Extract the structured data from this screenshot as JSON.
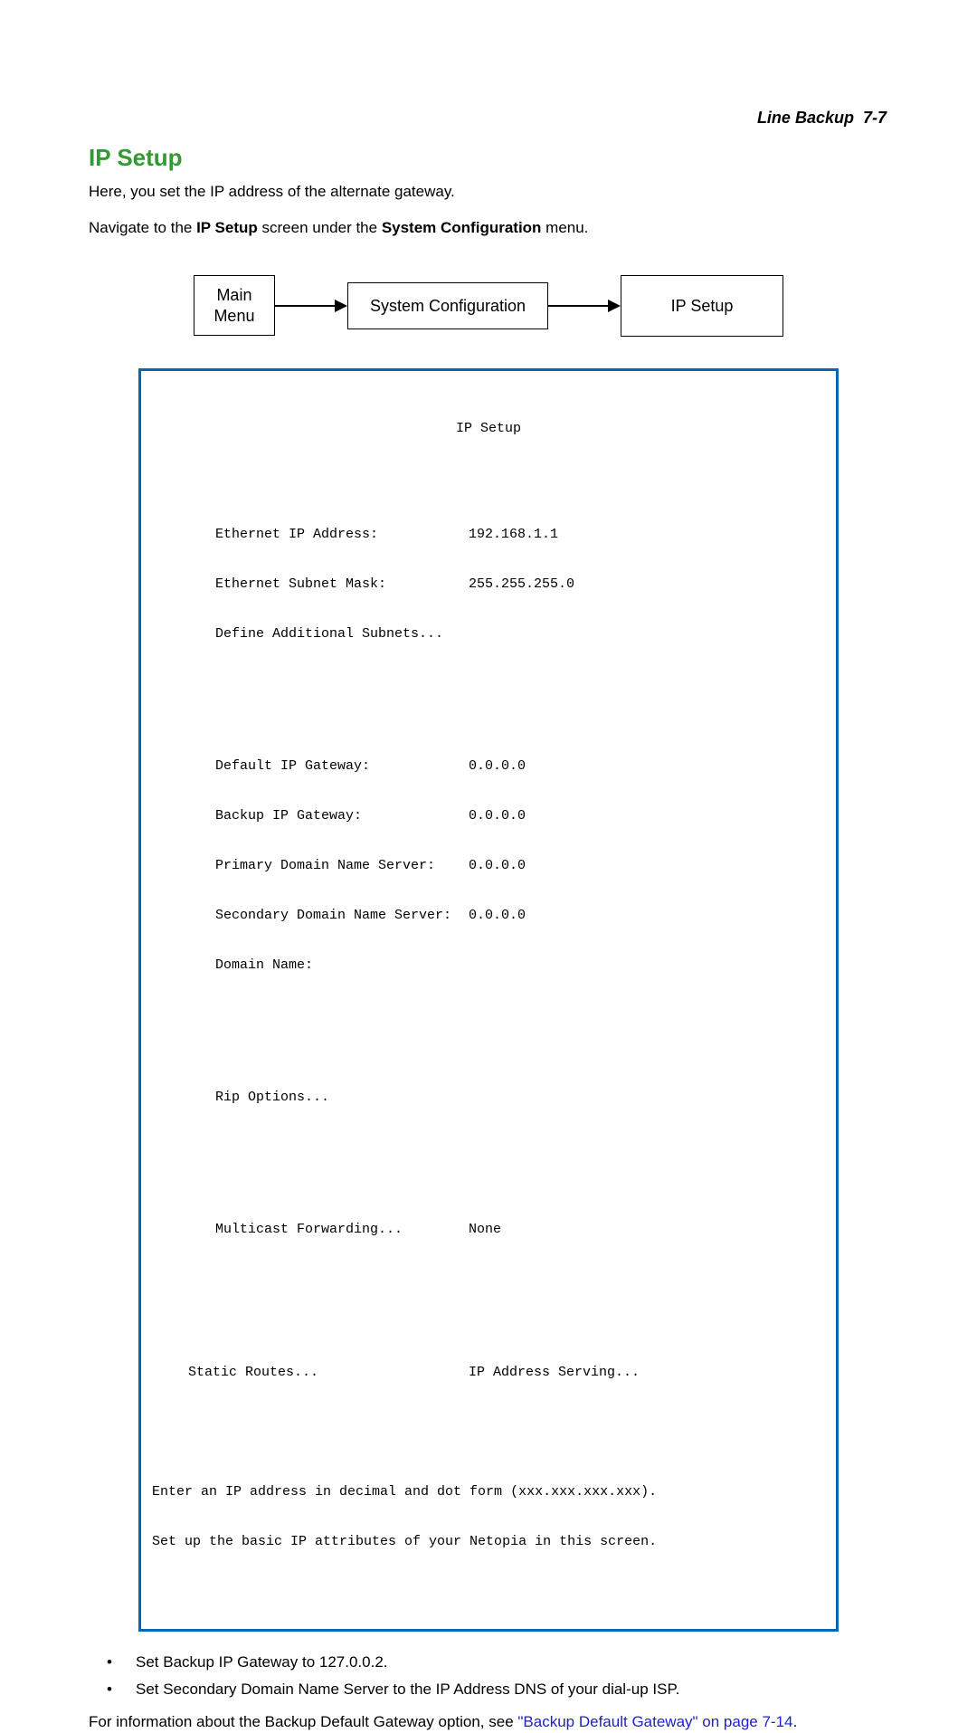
{
  "header": {
    "section": "Line Backup",
    "page": "7-7"
  },
  "heading": "IP Setup",
  "intro": "Here, you set the IP address of the alternate gateway.",
  "nav_text": {
    "pre": "Navigate to the ",
    "bold1": "IP Setup",
    "mid": " screen under the ",
    "bold2": "System Configuration",
    "post": " menu."
  },
  "diagram": {
    "box1_l1": "Main",
    "box1_l2": "Menu",
    "box2": "System Configuration",
    "box3": "IP Setup"
  },
  "terminal": {
    "title": "IP Setup",
    "rows1": [
      {
        "label": "Ethernet IP Address:",
        "value": "192.168.1.1"
      },
      {
        "label": "Ethernet Subnet Mask:",
        "value": "255.255.255.0"
      },
      {
        "label": "Define Additional Subnets...",
        "value": ""
      }
    ],
    "rows2": [
      {
        "label": "Default IP Gateway:",
        "value": "0.0.0.0"
      },
      {
        "label": "Backup IP Gateway:",
        "value": "0.0.0.0"
      },
      {
        "label": "Primary Domain Name Server:",
        "value": "0.0.0.0"
      },
      {
        "label": "Secondary Domain Name Server:",
        "value": "0.0.0.0"
      },
      {
        "label": "Domain Name:",
        "value": ""
      }
    ],
    "rows3": [
      {
        "label": "Rip Options...",
        "value": ""
      }
    ],
    "rows4": [
      {
        "label": "Multicast Forwarding...",
        "value": "None"
      }
    ],
    "bottom_left": "Static Routes...",
    "bottom_right": "IP Address Serving...",
    "footer1": "Enter an IP address in decimal and dot form (xxx.xxx.xxx.xxx).",
    "footer2": "Set up the basic IP attributes of your Netopia in this screen."
  },
  "bullets": [
    {
      "pre": "Set ",
      "bold": "Backup IP Gateway",
      "post": " to 127.0.0.2."
    },
    {
      "pre": "Set ",
      "bold": "Secondary Domain Name Server",
      "post": " to the IP Address DNS of your dial-up ISP."
    }
  ],
  "footer_text": {
    "pre": "For information about the Backup Default Gateway option, see ",
    "link": "\"Backup Default Gateway\" on page 7-14",
    "post": "."
  }
}
